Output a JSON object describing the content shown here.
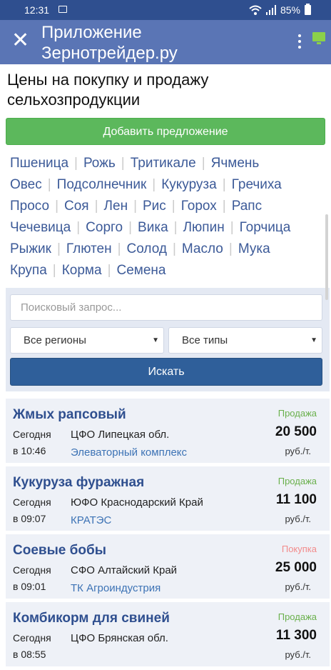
{
  "status_bar": {
    "time": "12:31",
    "battery": "85%"
  },
  "app_bar": {
    "title_line1": "Приложение",
    "title_line2": "Зернотрейдер.ру"
  },
  "page": {
    "heading_line1": "Цены на покупку и продажу",
    "heading_line2": "сельхозпродукции",
    "add_button": "Добавить предложение"
  },
  "categories": [
    [
      "Пшеница",
      "Рожь",
      "Тритикале",
      "Ячмень"
    ],
    [
      "Овес",
      "Подсолнечник",
      "Кукуруза",
      "Гречиха"
    ],
    [
      "Просо",
      "Соя",
      "Лен",
      "Рис",
      "Горох",
      "Рапс"
    ],
    [
      "Чечевица",
      "Сорго",
      "Вика",
      "Люпин",
      "Горчица"
    ],
    [
      "Рыжик",
      "Глютен",
      "Солод",
      "Масло",
      "Мука"
    ],
    [
      "Крупа",
      "Корма",
      "Семена"
    ]
  ],
  "search": {
    "placeholder": "Поисковый запрос...",
    "region": "Все регионы",
    "type": "Все типы",
    "button": "Искать"
  },
  "colors": {
    "sale": "#6ab04c",
    "buy": "#f28b8b",
    "accent": "#2f4f8f"
  },
  "listings": [
    {
      "name": "Жмых рапсовый",
      "date_line1": "Сегодня",
      "date_line2": "в 10:46",
      "region": "ЦФО Липецкая обл.",
      "company": "Элеваторный комплекс",
      "type": "Продажа",
      "type_kind": "sale",
      "price": "20 500",
      "unit": "руб./т."
    },
    {
      "name": "Кукуруза фуражная",
      "date_line1": "Сегодня",
      "date_line2": "в 09:07",
      "region": "ЮФО Краснодарский Край",
      "company": "КРАТЭС",
      "type": "Продажа",
      "type_kind": "sale",
      "price": "11 100",
      "unit": "руб./т."
    },
    {
      "name": "Соевые бобы",
      "date_line1": "Сегодня",
      "date_line2": "в 09:01",
      "region": "СФО Алтайский Край",
      "company": "ТК Агроиндустрия",
      "type": "Покупка",
      "type_kind": "buy",
      "price": "25 000",
      "unit": "руб./т."
    },
    {
      "name": "Комбикорм для свиней",
      "date_line1": "Сегодня",
      "date_line2": "в 08:55",
      "region": "ЦФО Брянская обл.",
      "company": "",
      "type": "Продажа",
      "type_kind": "sale",
      "price": "11 300",
      "unit": "руб./т."
    }
  ]
}
